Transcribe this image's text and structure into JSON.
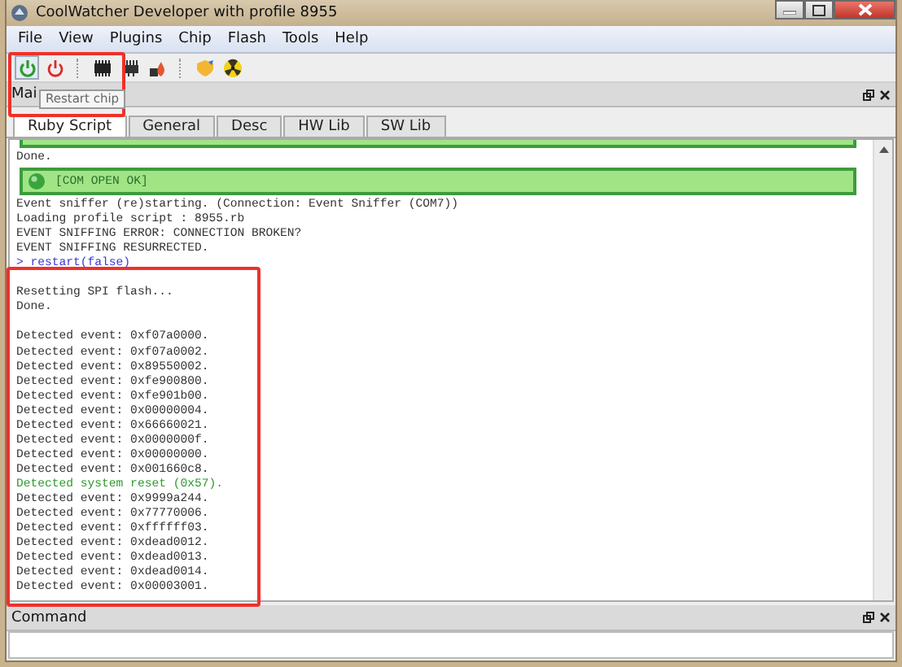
{
  "window": {
    "title": "CoolWatcher Developer with profile 8955"
  },
  "menu": [
    "File",
    "View",
    "Plugins",
    "Chip",
    "Flash",
    "Tools",
    "Help"
  ],
  "toolbar": {
    "tooltip": "Restart chip"
  },
  "main_dock": {
    "title": "Mai"
  },
  "tabs": [
    {
      "label": "Ruby Script",
      "selected": true
    },
    {
      "label": "General",
      "selected": false
    },
    {
      "label": "Desc",
      "selected": false
    },
    {
      "label": "HW Lib",
      "selected": false
    },
    {
      "label": "SW Lib",
      "selected": false
    }
  ],
  "console": [
    {
      "kind": "bar_cut"
    },
    {
      "kind": "plain",
      "text": "Done."
    },
    {
      "kind": "bar",
      "text": "[COM OPEN OK]"
    },
    {
      "kind": "plain",
      "text": "Event sniffer (re)starting. (Connection: Event Sniffer (COM7))"
    },
    {
      "kind": "plain",
      "text": "Loading profile script : 8955.rb"
    },
    {
      "kind": "plain",
      "text": "EVENT SNIFFING ERROR: CONNECTION BROKEN?"
    },
    {
      "kind": "plain",
      "text": "EVENT SNIFFING RESURRECTED."
    },
    {
      "kind": "command",
      "text": "> restart(false)"
    },
    {
      "kind": "blank"
    },
    {
      "kind": "plain",
      "text": "Resetting SPI flash..."
    },
    {
      "kind": "plain",
      "text": "Done."
    },
    {
      "kind": "blank"
    },
    {
      "kind": "plain",
      "text": "Detected event: 0xf07a0000."
    },
    {
      "kind": "plain",
      "text": "Detected event: 0xf07a0002."
    },
    {
      "kind": "plain",
      "text": "Detected event: 0x89550002."
    },
    {
      "kind": "plain",
      "text": "Detected event: 0xfe900800."
    },
    {
      "kind": "plain",
      "text": "Detected event: 0xfe901b00."
    },
    {
      "kind": "plain",
      "text": "Detected event: 0x00000004."
    },
    {
      "kind": "plain",
      "text": "Detected event: 0x66660021."
    },
    {
      "kind": "plain",
      "text": "Detected event: 0x0000000f."
    },
    {
      "kind": "plain",
      "text": "Detected event: 0x00000000."
    },
    {
      "kind": "plain",
      "text": "Detected event: 0x001660c8."
    },
    {
      "kind": "system",
      "text": "Detected system reset (0x57)."
    },
    {
      "kind": "plain",
      "text": "Detected event: 0x9999a244."
    },
    {
      "kind": "plain",
      "text": "Detected event: 0x77770006."
    },
    {
      "kind": "plain",
      "text": "Detected event: 0xffffff03."
    },
    {
      "kind": "plain",
      "text": "Detected event: 0xdead0012."
    },
    {
      "kind": "plain",
      "text": "Detected event: 0xdead0013."
    },
    {
      "kind": "plain",
      "text": "Detected event: 0xdead0014."
    },
    {
      "kind": "plain",
      "text": "Detected event: 0x00003001."
    }
  ],
  "command_dock": {
    "title": "Command"
  }
}
